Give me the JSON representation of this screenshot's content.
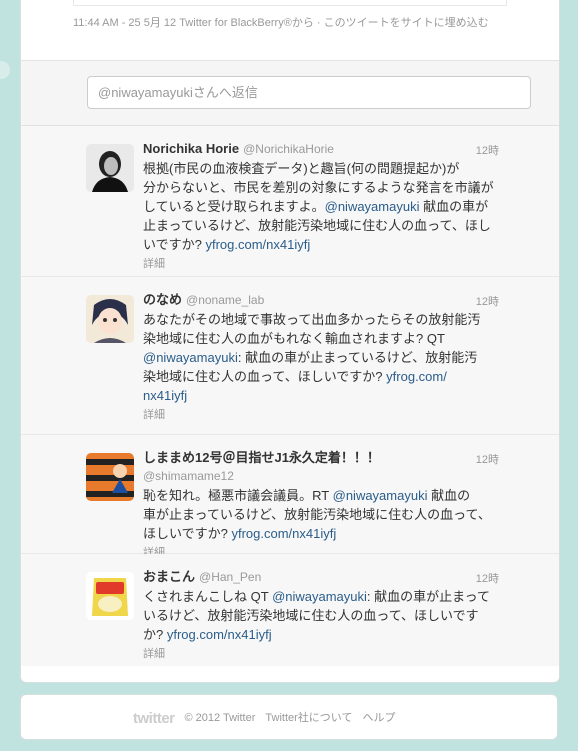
{
  "meta": {
    "timestamp_line": "11:44 AM - 25 5月 12 Twitter for BlackBerry®から · このツイートをサイトに埋め込む"
  },
  "reply": {
    "placeholder": "@niwayamayukiさんへ返信"
  },
  "tweets": [
    {
      "fullname": "Norichika Horie",
      "username": "@NorichikaHorie",
      "time": "12時",
      "text_lines": [
        "根拠(市民の血液検査データ)と趣旨(何の問題提起か)が",
        "分からないと、市民を差別の対象にするような発言を市議が",
        "していると受け取られますよ。",
        "止まっているけど、放射能汚染地域に住む人の血って、ほし",
        "いですか?"
      ],
      "mention": "@niwayamayuki",
      "mention_tail": " 献血の車が",
      "link": "yfrog.com/nx41iyfj",
      "details": "詳細",
      "avatar_icon": "portrait-avatar-icon"
    },
    {
      "fullname": "のなめ",
      "username": "@noname_lab",
      "time": "12時",
      "text_lines": [
        "あなたがその地域で事故って出血多かったらその放射能汚",
        "染地域に住む人の血がもれなく輸血されますよ? QT",
        ": 献血の車が止まっているけど、放射能汚",
        "染地域に住む人の血って、ほしいですか?"
      ],
      "mention": "@niwayamayuki",
      "link": "yfrog.com/",
      "link2": "nx41iyfj",
      "details": "詳細",
      "avatar_icon": "anime-avatar-icon"
    },
    {
      "fullname": "しままめ12号＠目指せJ1永久定着！！！",
      "username": "@shimamame12",
      "time": "12時",
      "text_lines": [
        "恥を知れ。極悪市議会議員。RT",
        " 献血の",
        "車が止まっているけど、放射能汚染地域に住む人の血って、",
        "ほしいですか?"
      ],
      "mention": "@niwayamayuki",
      "link": "yfrog.com/nx41iyfj",
      "details": "詳細",
      "avatar_icon": "striped-avatar-icon"
    },
    {
      "fullname": "おまこん",
      "username": "@Han_Pen",
      "time": "12時",
      "text_lines": [
        "くされまんこしね QT",
        ": 献血の車が止まって",
        "いるけど、放射能汚染地域に住む人の血って、ほしいです",
        "か?"
      ],
      "mention": "@niwayamayuki",
      "link": "yfrog.com/nx41iyfj",
      "details": "詳細",
      "avatar_icon": "cheese-bag-avatar-icon"
    }
  ],
  "footer": {
    "logo": "twitter",
    "copyright": "© 2012 Twitter",
    "about": "Twitter社について",
    "help": "ヘルプ"
  },
  "colors": {
    "background": "#c0e3e0",
    "link": "#2a5d8a",
    "muted": "#999999"
  }
}
